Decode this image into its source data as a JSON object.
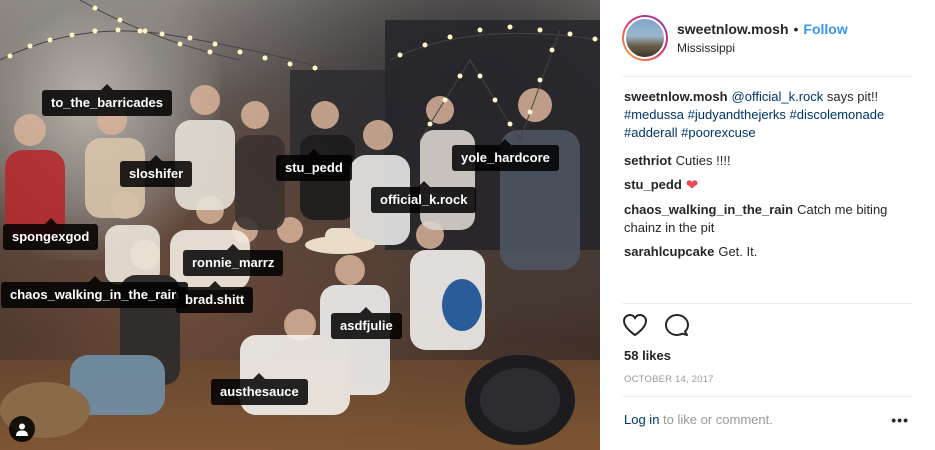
{
  "photo": {
    "tags": [
      {
        "name": "to_the_barricades"
      },
      {
        "name": "sloshifer"
      },
      {
        "name": "stu_pedd"
      },
      {
        "name": "yole_hardcore"
      },
      {
        "name": "official_k.rock"
      },
      {
        "name": "spongexgod"
      },
      {
        "name": "ronnie_marrz"
      },
      {
        "name": "chaos_walking_in_the_rain"
      },
      {
        "name": "brad.shitt"
      },
      {
        "name": "asdfjulie"
      },
      {
        "name": "austhesauce"
      }
    ],
    "user_tags_icon": "person-icon"
  },
  "header": {
    "username": "sweetnlow.mosh",
    "separator": "•",
    "follow_label": "Follow",
    "location": "Mississippi"
  },
  "caption": {
    "username": "sweetnlow.mosh",
    "mention": "@official_k.rock",
    "text": " says pit!!",
    "hashtags": [
      "#medussa",
      "#judyandthejerks",
      "#discolemonade",
      "#adderall",
      "#poorexcuse"
    ]
  },
  "comments": [
    {
      "user": "sethriot",
      "text": "Cuties !!!!"
    },
    {
      "user": "stu_pedd",
      "text": "❤"
    },
    {
      "user": "chaos_walking_in_the_rain",
      "text": "Catch me biting chainz in the pit"
    },
    {
      "user": "sarahlcupcake",
      "text": "Get. It."
    }
  ],
  "actions": {
    "like_icon": "heart-outline-icon",
    "comment_icon": "comment-bubble-icon"
  },
  "likes": "58 likes",
  "date": "OCTOBER 14, 2017",
  "login": {
    "link": "Log in",
    "rest": " to like or comment."
  },
  "more_label": "•••",
  "colors": {
    "link": "#003569",
    "follow": "#3897f0",
    "heart": "#ed4956",
    "muted": "#999999"
  }
}
